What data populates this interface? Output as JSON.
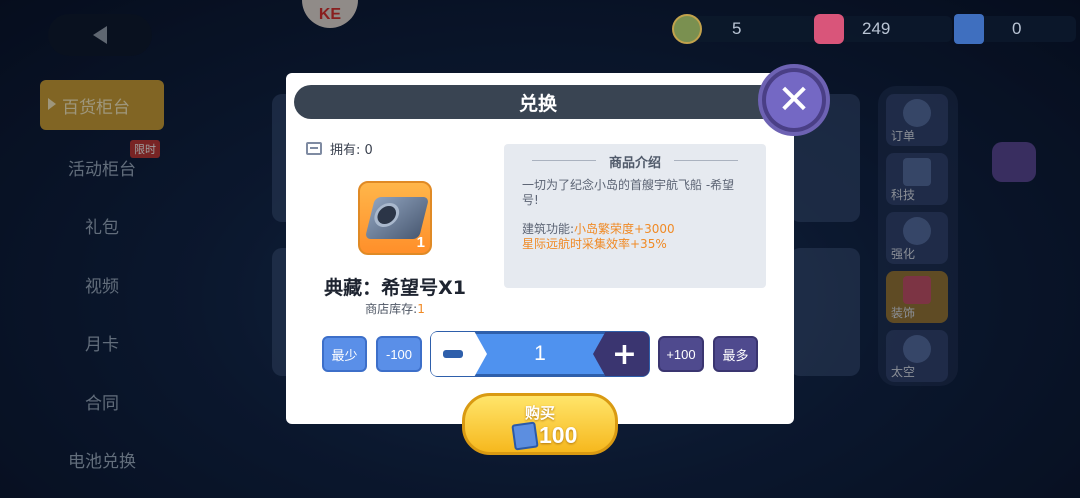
{
  "top_bar": {
    "badge_text": "KE",
    "resources": [
      {
        "icon": "gear-medal-icon",
        "value": "5"
      },
      {
        "icon": "paint-roller-icon",
        "value": "249"
      },
      {
        "icon": "blue-ticket-icon",
        "value": "0"
      }
    ]
  },
  "left_menu": {
    "items": [
      {
        "label": "百货柜台",
        "active": true
      },
      {
        "label": "活动柜台",
        "tag": "限时"
      },
      {
        "label": "礼包"
      },
      {
        "label": "视频"
      },
      {
        "label": "月卡"
      },
      {
        "label": "合同"
      },
      {
        "label": "电池兑换"
      }
    ]
  },
  "right_menu": {
    "items": [
      {
        "label": "订单"
      },
      {
        "label": "科技"
      },
      {
        "label": "强化"
      },
      {
        "label": "装饰",
        "selected": true
      },
      {
        "label": "太空"
      }
    ]
  },
  "dialog": {
    "title": "兑换",
    "owned": "拥有: 0",
    "item": {
      "name": "典藏：希望号X1",
      "icon_qty": "1",
      "stock_label": "商店库存:",
      "stock_value": "1"
    },
    "description": {
      "title": "商品介绍",
      "text": "一切为了纪念小岛的首艘宇航飞船 -希望号!",
      "func_label": "建筑功能:",
      "func_value_1": "小岛繁荣度+3000",
      "func_value_2": "星际远航时采集效率+35%"
    },
    "quantity": {
      "min_label": "最少",
      "minus100_label": "-100",
      "value": "1",
      "plus100_label": "+100",
      "max_label": "最多"
    },
    "buy": {
      "label": "购买",
      "price": "100"
    }
  },
  "colors": {
    "dialog_title_bg": "#394452",
    "accent_orange": "#f08a25",
    "qty_blue": "#4f92ef",
    "buy_yellow": "#f6b81e",
    "close_purple": "#7468c4"
  }
}
